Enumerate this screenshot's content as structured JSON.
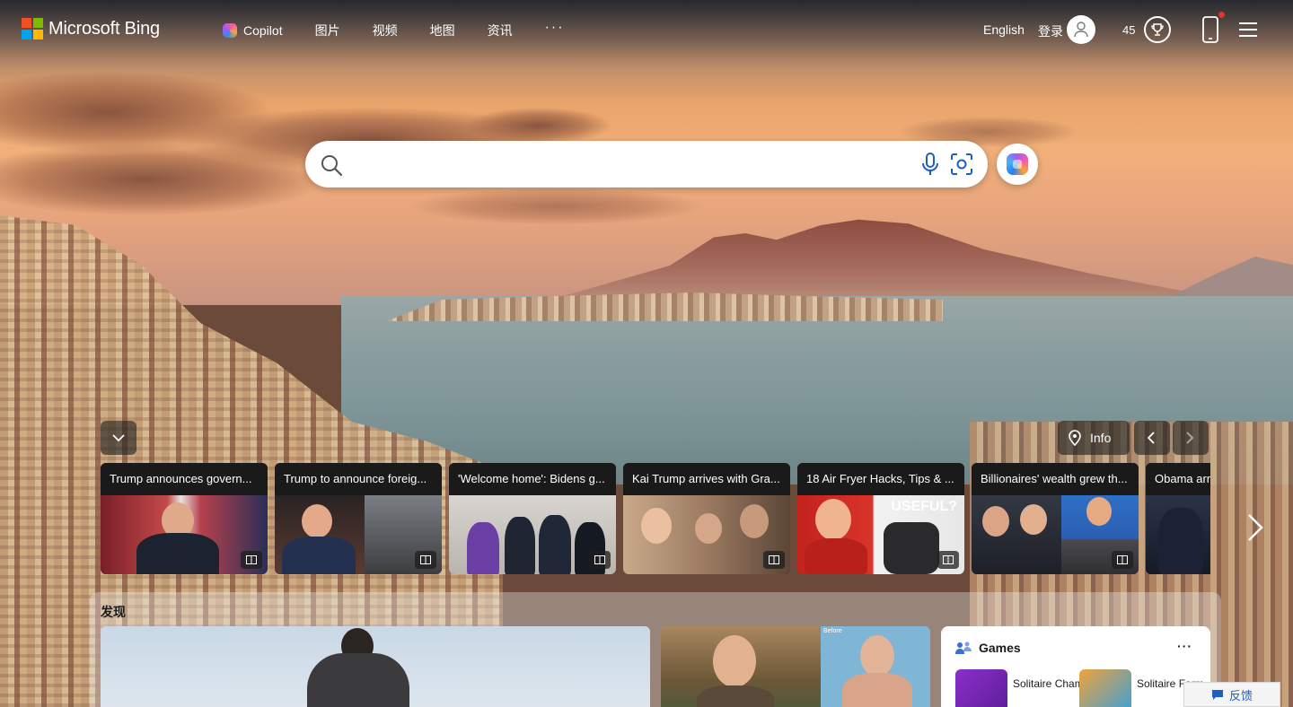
{
  "header": {
    "brand": "Microsoft Bing",
    "nav": [
      {
        "label": "Copilot"
      },
      {
        "label": "图片"
      },
      {
        "label": "视频"
      },
      {
        "label": "地图"
      },
      {
        "label": "资讯"
      }
    ],
    "more": "···",
    "language": "English",
    "login": "登录",
    "points": "45"
  },
  "search": {
    "placeholder": "",
    "value": ""
  },
  "carousel": {
    "info_label": "Info",
    "news": [
      {
        "title": "Trump announces govern..."
      },
      {
        "title": "Trump to announce foreig..."
      },
      {
        "title": "'Welcome home': Bidens g..."
      },
      {
        "title": "Kai Trump arrives with Gra..."
      },
      {
        "title": "18 Air Fryer Hacks, Tips & ..."
      },
      {
        "title": "Billionaires' wealth grew th..."
      },
      {
        "title": "Obama arr"
      }
    ],
    "card5_overlay": "USEFUL?"
  },
  "discover": {
    "title": "发现",
    "before_label": "Before",
    "games": {
      "title": "Games",
      "more": "···",
      "items": [
        {
          "name": "Solitaire Champion"
        },
        {
          "name": "Solitaire Farm"
        }
      ]
    }
  },
  "feedback": "反馈",
  "colors": {
    "accent": "#1e5fbf",
    "notification": "#e4342c"
  }
}
